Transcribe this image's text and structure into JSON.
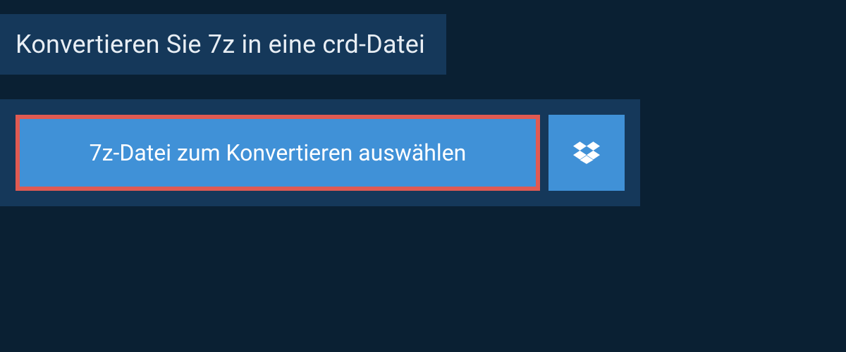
{
  "header": {
    "title": "Konvertieren Sie 7z in eine crd-Datei"
  },
  "actions": {
    "select_file_label": "7z-Datei zum Konvertieren auswählen",
    "dropbox_icon": "dropbox"
  },
  "colors": {
    "background": "#0a2033",
    "panel": "#15385a",
    "button": "#4091d7",
    "highlight_border": "#e05a52",
    "text_light": "#e8eef4",
    "text_white": "#ffffff"
  }
}
